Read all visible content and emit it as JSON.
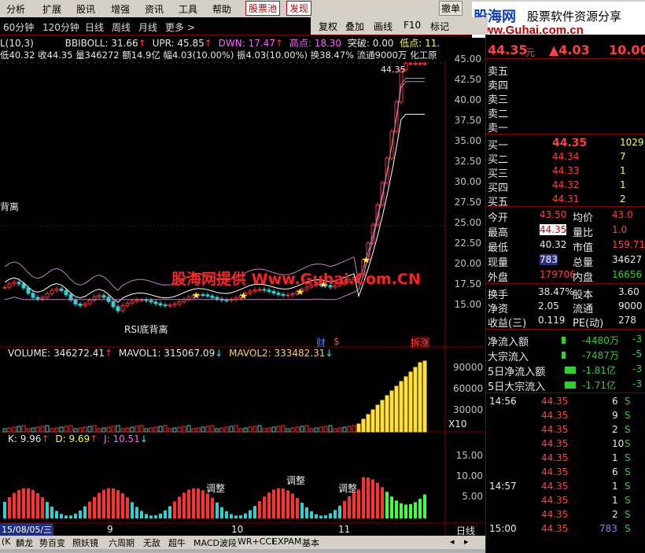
{
  "menu": {
    "items": [
      "分析",
      "扩展",
      "股讯",
      "增强",
      "资讯",
      "工具",
      "帮助"
    ],
    "stock_pool": "股票池",
    "discover": "发现",
    "cancel": "撤单"
  },
  "logo": {
    "cn": "股海网",
    "slogan": "股票软件资源分享",
    "url": "www.Guhai.com.cn"
  },
  "periods": [
    "60分钟",
    "120分钟",
    "日线",
    "周线",
    "月线",
    "更多 >"
  ],
  "tools": [
    "复权",
    "叠加",
    "画线",
    "F10",
    "标记"
  ],
  "indicator_line1": {
    "left": "L(10,3)",
    "bbiboll": "BBIBOLL: 31.66",
    "upr": "UPR: 45.85",
    "dwn": "DWN: 17.47",
    "high": "高点: 18.30",
    "breakout": "突破: 0.00",
    "low": "低点: 11."
  },
  "indicator_line2": {
    "text": "低40.32 收44.35 量346272 额14.9亿 幅4.03(10.00%) 振4.03(10.00%) 换38.47% 流通9000万 化工原"
  },
  "price_axis": [
    "45.00",
    "42.50",
    "40.00",
    "37.50",
    "35.00",
    "32.50",
    "30.00",
    "27.50",
    "25.00",
    "22.50",
    "20.00",
    "17.50",
    "15.00"
  ],
  "annotations": {
    "price_peak": "44.35",
    "divergence_top": "背离",
    "rsi_bottom": "RSI底背离",
    "cai": "财",
    "s_mark": "$",
    "split": "拆涨",
    "watermark": "股海网提供 Www.Guhai.Com.CN"
  },
  "volume": {
    "label": "VOLUME: 346272.41",
    "mavol1": "MAVOL1: 315067.09",
    "mavol2": "MAVOL2: 333482.31",
    "axis": [
      "90000",
      "60000",
      "30000"
    ],
    "unit": "X10"
  },
  "kdj": {
    "k": "K: 9.96",
    "d": "D: 9.69",
    "j": "J: 10.51",
    "axis": [
      "15.00",
      "10.00",
      "5.00"
    ],
    "adjust_labels": [
      "调整",
      "调整",
      "调整"
    ]
  },
  "date_axis": {
    "current": "15/08/05/三",
    "months": [
      "9",
      "10",
      "11"
    ],
    "period": "日线"
  },
  "tabs": [
    "(K",
    "麟龙",
    "势百变",
    "照妖镜",
    "六周期",
    "无敌",
    "超牛",
    "MACD波段",
    "WR+CCI",
    "EXPAM",
    "基本"
  ],
  "quote": {
    "price": "44.35",
    "price_unit": "元",
    "change": "▲4.03",
    "change_pct": "10.00",
    "sell": [
      {
        "label": "卖五",
        "price": "",
        "vol": ""
      },
      {
        "label": "卖四",
        "price": "",
        "vol": ""
      },
      {
        "label": "卖三",
        "price": "",
        "vol": ""
      },
      {
        "label": "卖二",
        "price": "",
        "vol": ""
      },
      {
        "label": "卖一",
        "price": "",
        "vol": ""
      }
    ],
    "buy": [
      {
        "label": "买一",
        "price": "44.35",
        "vol": "1029"
      },
      {
        "label": "买二",
        "price": "44.34",
        "vol": "7"
      },
      {
        "label": "买三",
        "price": "44.33",
        "vol": "1"
      },
      {
        "label": "买四",
        "price": "44.32",
        "vol": "1"
      },
      {
        "label": "买五",
        "price": "44.31",
        "vol": "2"
      }
    ],
    "stats": [
      {
        "l1": "今开",
        "v1": "43.50",
        "l2": "均价",
        "v2": "43.0"
      },
      {
        "l1": "最高",
        "v1": "44.35",
        "l2": "量比",
        "v2": "1.0"
      },
      {
        "l1": "最低",
        "v1": "40.32",
        "l2": "市值",
        "v2": "159.71"
      },
      {
        "l1": "现量",
        "v1": "783",
        "l2": "总量",
        "v2": "34627"
      },
      {
        "l1": "外盘",
        "v1": "179706",
        "l2": "内盘",
        "v2": "16656"
      }
    ],
    "fund": [
      {
        "l1": "换手",
        "v1": "38.47%",
        "l2": "股本",
        "v2": "3.60"
      },
      {
        "l1": "净资",
        "v1": "2.05",
        "l2": "流通",
        "v2": "9000"
      },
      {
        "l1": "收益(三)",
        "v1": "0.119",
        "l2": "PE(动)",
        "v2": "278"
      }
    ],
    "flow": [
      {
        "label": "净流入额",
        "value": "-4480万",
        "pct": "-3"
      },
      {
        "label": "大宗流入",
        "value": "-7487万",
        "pct": "-5"
      },
      {
        "label": "5日净流入额",
        "value": "-1.81亿",
        "pct": "-3"
      },
      {
        "label": "5日大宗流入",
        "value": "-1.71亿",
        "pct": "-3"
      }
    ],
    "ticks": [
      {
        "time": "14:56",
        "price": "44.35",
        "vol": "6",
        "dir": "S"
      },
      {
        "time": "",
        "price": "44.35",
        "vol": "9",
        "dir": "S"
      },
      {
        "time": "",
        "price": "44.35",
        "vol": "2",
        "dir": "S"
      },
      {
        "time": "",
        "price": "44.35",
        "vol": "10",
        "dir": "S"
      },
      {
        "time": "",
        "price": "44.35",
        "vol": "1",
        "dir": "S"
      },
      {
        "time": "",
        "price": "44.35",
        "vol": "6",
        "dir": "S"
      },
      {
        "time": "14:57",
        "price": "44.35",
        "vol": "1",
        "dir": "S"
      },
      {
        "time": "",
        "price": "44.35",
        "vol": "1",
        "dir": "S"
      },
      {
        "time": "",
        "price": "44.35",
        "vol": "2",
        "dir": "S"
      },
      {
        "time": "15:00",
        "price": "44.35",
        "vol": "783",
        "dir": "S"
      }
    ]
  }
}
